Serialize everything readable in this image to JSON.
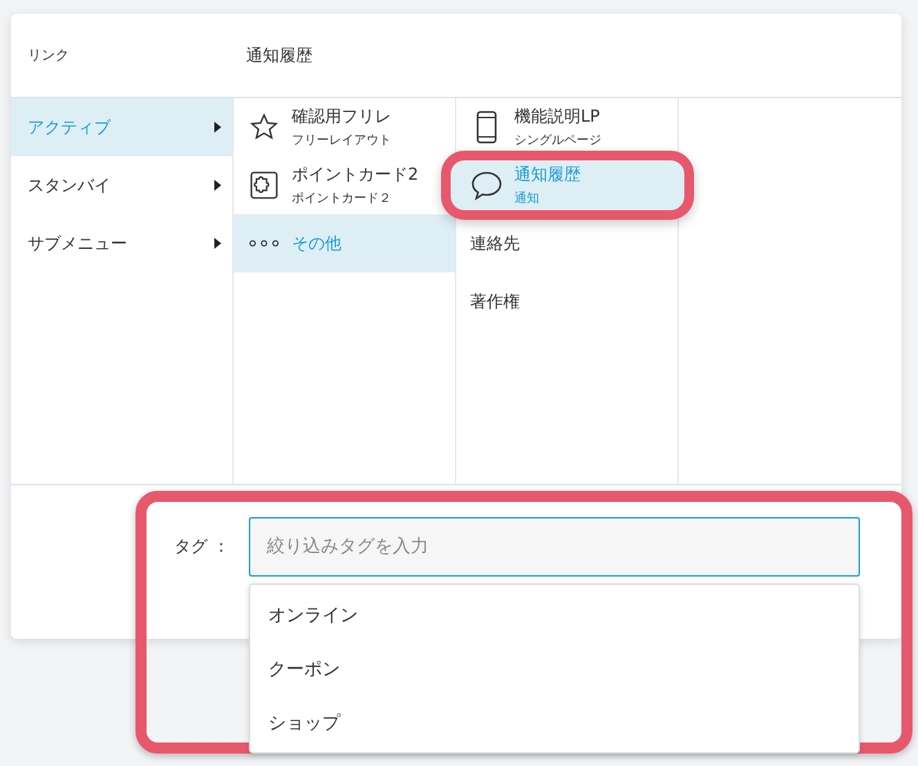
{
  "dialog": {
    "header": {
      "column_1": "リンク",
      "column_2": "通知履歴"
    },
    "categories": [
      {
        "label": "アクティブ",
        "selected": true
      },
      {
        "label": "スタンバイ",
        "selected": false
      },
      {
        "label": "サブメニュー",
        "selected": false
      }
    ],
    "items": [
      {
        "kind": "star",
        "title": "確認用フリレ",
        "subtitle": "フリーレイアウト",
        "selected": false
      },
      {
        "kind": "puzzle",
        "title": "ポイントカード2",
        "subtitle": "ポイントカード２",
        "selected": false
      },
      {
        "kind": "more",
        "title": "その他",
        "selected": true
      }
    ],
    "pages": [
      {
        "kind": "phone",
        "title": "機能説明LP",
        "subtitle": "シングルページ",
        "selected": false,
        "highlighted": false
      },
      {
        "kind": "speech",
        "title": "通知履歴",
        "subtitle": "通知",
        "selected": true,
        "highlighted": true
      },
      {
        "kind": "plain",
        "title": "連絡先",
        "selected": false,
        "highlighted": false
      },
      {
        "kind": "plain",
        "title": "著作権",
        "selected": false,
        "highlighted": false
      }
    ],
    "tag": {
      "label": "タグ ：",
      "placeholder": "絞り込みタグを入力",
      "highlighted": true,
      "suggestions": [
        "オンライン",
        "クーポン",
        "ショップ"
      ]
    }
  }
}
